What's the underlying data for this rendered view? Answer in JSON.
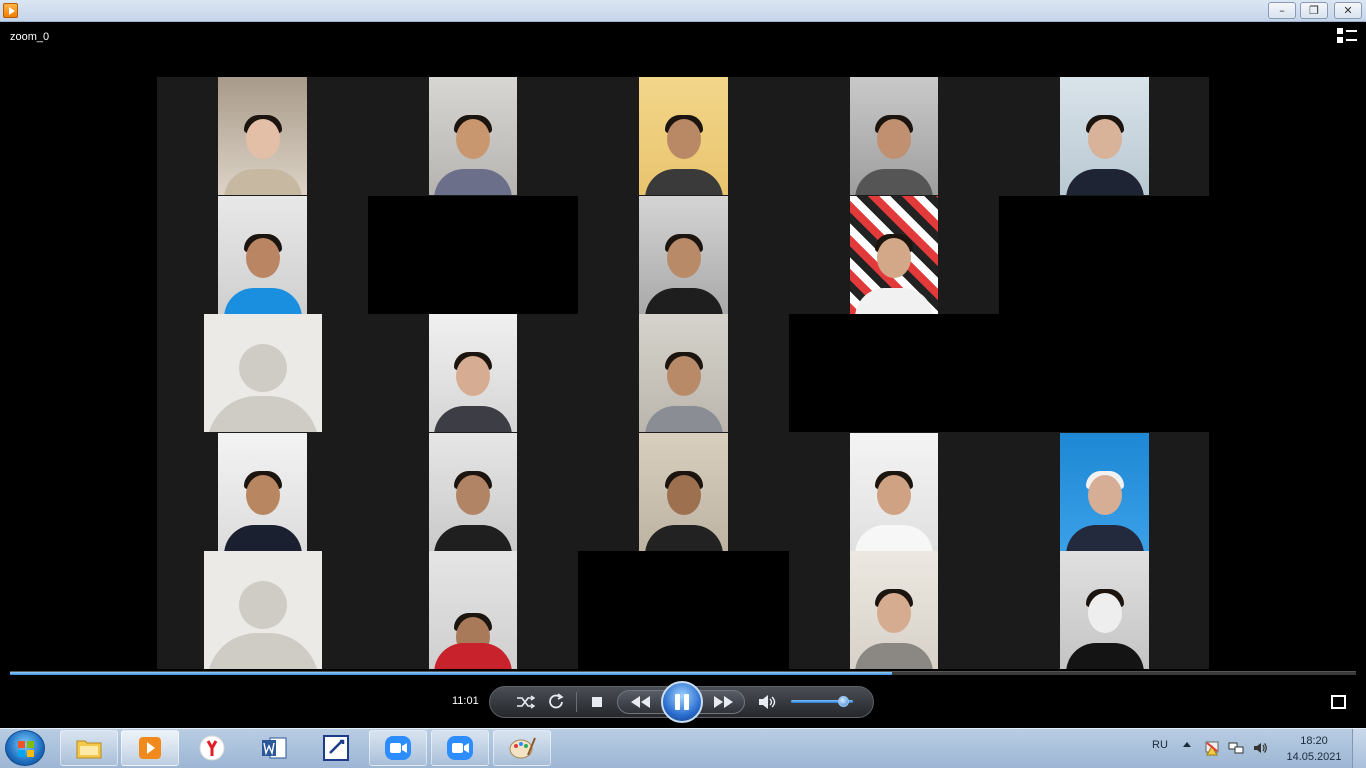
{
  "window": {
    "title_icon": "media-player-icon",
    "minimize": "–",
    "restore": "❐",
    "close": "✕"
  },
  "player": {
    "title": "zoom_0",
    "time": "11:01",
    "progress_fraction": 0.655,
    "volume_fraction": 0.85,
    "state": "playing"
  },
  "taskbar": {
    "apps": [
      "file-explorer",
      "media-player",
      "yandex-browser",
      "microsoft-word",
      "telegram-like-app",
      "zoom",
      "zoom",
      "paint"
    ],
    "language": "RU",
    "time": "18:20",
    "date": "14.05.2021"
  },
  "colors": {
    "accent": "#3c8ee0",
    "taskbar": "#9db6d3",
    "video_bg": "#1b1b1b"
  }
}
